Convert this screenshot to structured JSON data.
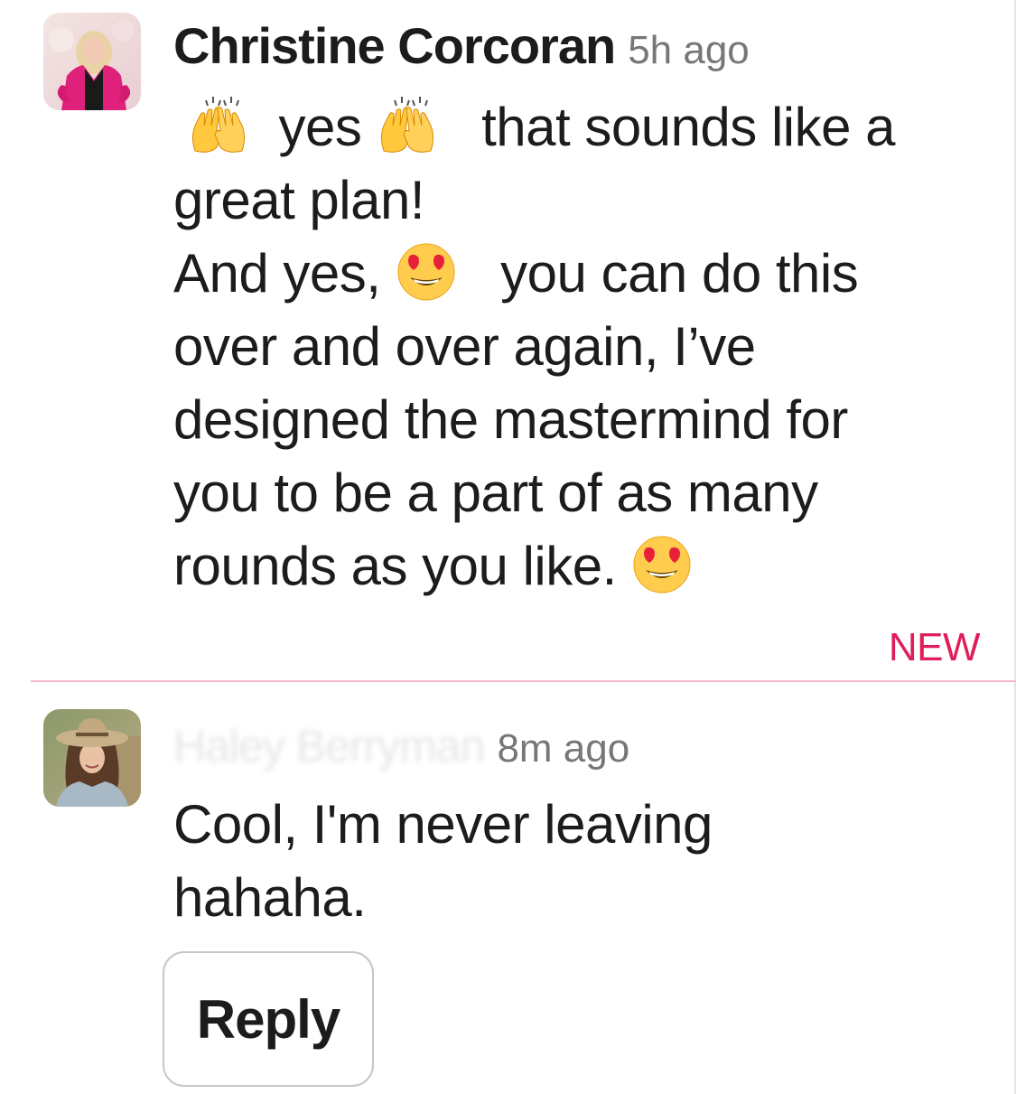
{
  "messages": [
    {
      "author": "Christine Corcoran",
      "time": "5h ago",
      "avatar_icon": "woman-pink-blazer-avatar",
      "body_lines": [
        {
          "text_a": "yes",
          "text_b": "that sounds like a",
          "emoji": "raising-hands-icon"
        },
        {
          "text": "great plan!"
        },
        {
          "text_a": "And yes,",
          "text_b": "you can do this",
          "emoji": "heart-eyes-icon"
        },
        {
          "text": "over and over again, I’ve"
        },
        {
          "text": "designed the mastermind for"
        },
        {
          "text": "you to be a part of as many"
        },
        {
          "text_a": "rounds as you like.",
          "emoji": "heart-eyes-icon"
        }
      ]
    },
    {
      "author": "Haley Berryman",
      "time": "8m ago",
      "avatar_icon": "woman-wide-brim-hat-avatar",
      "body_lines": [
        {
          "text": "Cool, I'm never leaving"
        },
        {
          "text": "hahaha."
        }
      ]
    }
  ],
  "divider_label": "NEW",
  "reply_label": "Reply",
  "colors": {
    "new_accent": "#e01e5a",
    "divider": "#f2b9cb",
    "text": "#1d1c1d",
    "muted": "#777777"
  }
}
